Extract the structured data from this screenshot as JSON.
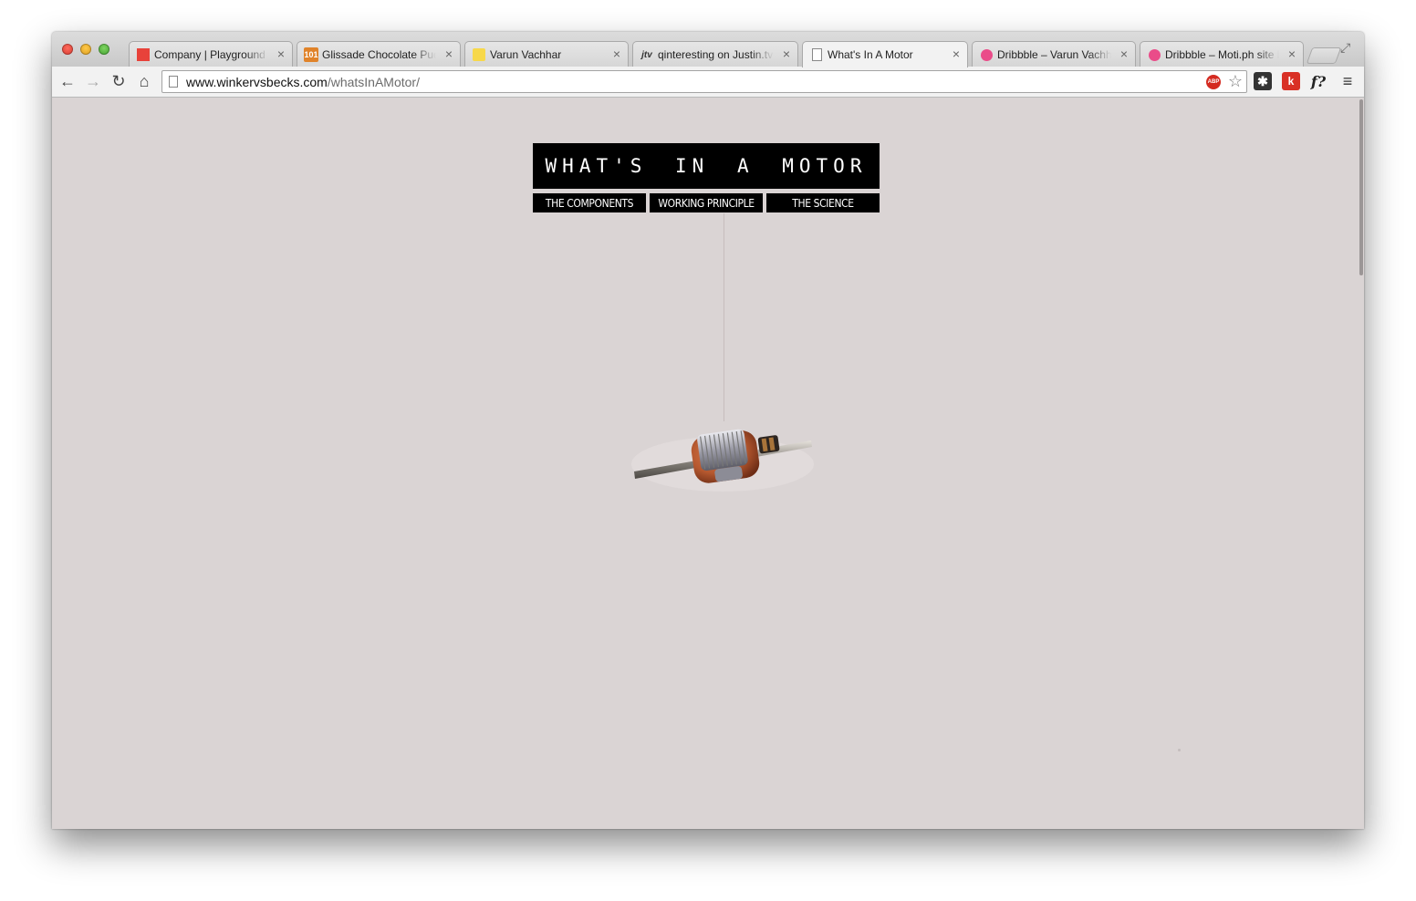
{
  "browser": {
    "tabs": [
      {
        "title": "Company | Playground In",
        "favicon": "red-square-icon",
        "color": "#e8423a",
        "active": false
      },
      {
        "title": "Glissade Chocolate Pudding",
        "favicon": "101-icon",
        "favicon_text": "101",
        "color": "#e0832a",
        "active": false
      },
      {
        "title": "Varun Vachhar",
        "favicon": "yellow-square-icon",
        "color": "#f7d84a",
        "active": false
      },
      {
        "title": "qinteresting on Justin.tv",
        "favicon": "justin-tv-icon",
        "favicon_text": "jtv",
        "color": "#333333",
        "active": false
      },
      {
        "title": "What's In A Motor",
        "favicon": "page-icon",
        "color": "#999999",
        "active": true
      },
      {
        "title": "Dribbble – Varun Vachhar",
        "favicon": "dribbble-icon",
        "color": "#ea4c89",
        "active": false
      },
      {
        "title": "Dribbble – Moti.ph site by",
        "favicon": "dribbble-icon",
        "color": "#ea4c89",
        "active": false
      }
    ],
    "close_glyph": "×",
    "url_host": "www.winkervsbecks.com",
    "url_path": "/whatsInAMotor/",
    "extensions": {
      "abp_label": "ABP",
      "k_label": "k",
      "fq_label": "f?"
    }
  },
  "page": {
    "title": "WHAT'S IN A MOTOR",
    "nav": [
      {
        "label": "THE COMPONENTS"
      },
      {
        "label": "WORKING PRINCIPLE"
      },
      {
        "label": "THE SCIENCE"
      }
    ]
  },
  "colors": {
    "page_background": "#dad4d4",
    "header_background": "#000000",
    "header_text": "#ffffff",
    "copper": "#b5582f"
  }
}
